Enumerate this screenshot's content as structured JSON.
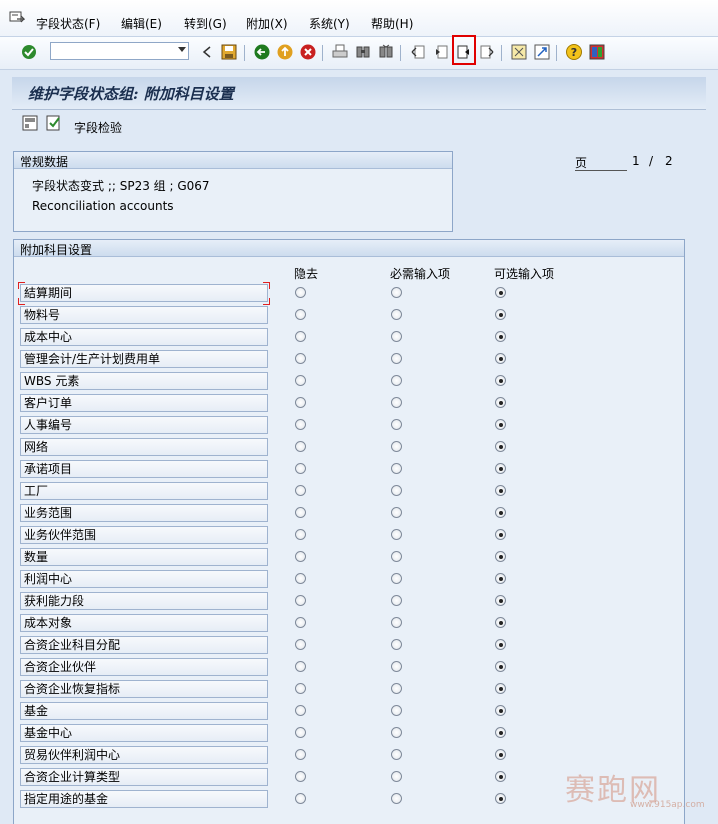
{
  "menu": {
    "items": [
      {
        "label": "字段状态(F)"
      },
      {
        "label": "编辑(E)"
      },
      {
        "label": "转到(G)"
      },
      {
        "label": "附加(X)"
      },
      {
        "label": "系统(Y)"
      },
      {
        "label": "帮助(H)"
      }
    ]
  },
  "toolbar": {
    "command_value": "",
    "icons": [
      "check-icon",
      "back-icon",
      "save-icon",
      "back-arrow-icon",
      "exit-icon",
      "cancel-icon",
      "print-icon",
      "find-icon",
      "find-next-icon",
      "first-page-icon",
      "prev-page-icon",
      "next-page-icon",
      "last-page-icon",
      "create-session-icon",
      "shortcut-icon",
      "help-icon",
      "layout-icon"
    ]
  },
  "title": "维护字段状态组: 附加科目设置",
  "app_toolbar": {
    "field_check_label": "字段检验"
  },
  "general": {
    "title": "常规数据",
    "variant_line": "字段状态变式 ;; SP23     组 ; G067",
    "description": "Reconciliation accounts"
  },
  "pager": {
    "label": "页",
    "current": "1",
    "separator": "/",
    "total": "2"
  },
  "additional": {
    "title": "附加科目设置",
    "columns": [
      "隐去",
      "必需输入项",
      "可选输入项"
    ],
    "rows": [
      {
        "label": "結算期间",
        "selected": 2
      },
      {
        "label": "物料号",
        "selected": 2
      },
      {
        "label": "成本中心",
        "selected": 2
      },
      {
        "label": "管理会计/生产计划费用单",
        "selected": 2
      },
      {
        "label": "WBS 元素",
        "selected": 2
      },
      {
        "label": "客户订单",
        "selected": 2
      },
      {
        "label": "人事编号",
        "selected": 2
      },
      {
        "label": "网络",
        "selected": 2
      },
      {
        "label": "承诺项目",
        "selected": 2
      },
      {
        "label": "工厂",
        "selected": 2
      },
      {
        "label": "业务范围",
        "selected": 2
      },
      {
        "label": "业务伙伴范围",
        "selected": 2
      },
      {
        "label": "数量",
        "selected": 2
      },
      {
        "label": "利润中心",
        "selected": 2
      },
      {
        "label": "获利能力段",
        "selected": 2
      },
      {
        "label": "成本对象",
        "selected": 2
      },
      {
        "label": "合资企业科目分配",
        "selected": 2
      },
      {
        "label": "合资企业伙伴",
        "selected": 2
      },
      {
        "label": "合资企业恢复指标",
        "selected": 2
      },
      {
        "label": "基金",
        "selected": 2
      },
      {
        "label": "基金中心",
        "selected": 2
      },
      {
        "label": "贸易伙伴利润中心",
        "selected": 2
      },
      {
        "label": "合资企业计算类型",
        "selected": 2
      },
      {
        "label": "指定用途的基金",
        "selected": 2
      }
    ]
  },
  "watermark": {
    "text": "赛跑网",
    "url": "www.915ap.com"
  }
}
